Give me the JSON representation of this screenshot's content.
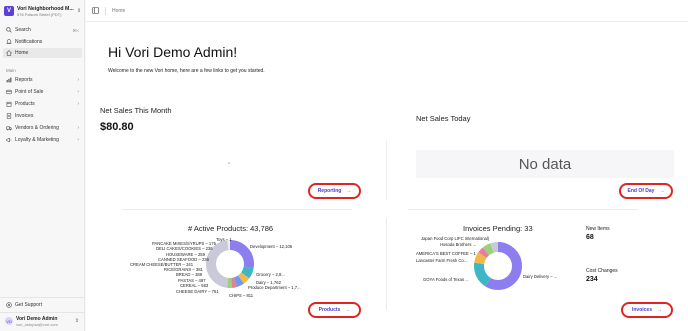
{
  "sidebar": {
    "store_name": "Vori Neighborhood M...",
    "store_address": "576 Folsom Street (PDT)",
    "logo_letter": "V",
    "search": {
      "label": "Search",
      "shortcut": "⌘K"
    },
    "notifications": {
      "label": "Notifications"
    },
    "home": {
      "label": "Home"
    },
    "section_main": "Main",
    "items": [
      {
        "label": "Reports",
        "icon": "chart-icon"
      },
      {
        "label": "Point of Sale",
        "icon": "pos-icon"
      },
      {
        "label": "Products",
        "icon": "box-icon"
      },
      {
        "label": "Invoices",
        "icon": "invoice-icon"
      },
      {
        "label": "Vendors & Ordering",
        "icon": "truck-icon"
      },
      {
        "label": "Loyalty & Marketing",
        "icon": "megaphone-icon"
      }
    ],
    "support": {
      "label": "Get Support"
    },
    "user": {
      "name": "Vori Demo Admin",
      "email": "vori_ostopsa@vori.com",
      "initials": "VD"
    }
  },
  "topbar": {
    "breadcrumb": "Home"
  },
  "main": {
    "greeting": "Hi Vori Demo Admin!",
    "welcome": "Welcome to the new Vori home, here are a few links to get you started.",
    "net_sales_month": {
      "title": "Net Sales This Month",
      "value": "$80.80",
      "button": "Reporting"
    },
    "net_sales_today": {
      "title": "Net Sales Today",
      "empty": "No data",
      "button": "End Of Day"
    },
    "active_products": {
      "title": "# Active Products: 43,786",
      "button": "Products",
      "labels_left": [
        "Toys – 1",
        "PANCAKE MIXES/SYRUPS – 175",
        "DELI CAKES/COOKIES – 236",
        "HOUSEWARE – 259",
        "CANNED SEAFOOD – 236",
        "CREAM CHEESE/BUTTER – 341",
        "RICE/GRAINS – 381",
        "BREAD – 389",
        "PASTAS – 497",
        "CEREAL – 563",
        "CHEESE DAIRY – 751"
      ],
      "labels_right": [
        "Development – 12,106",
        "Grocery – 2,9...",
        "Dairy – 1,762",
        "Produce Department – 1,7...",
        "CHIPS – 811"
      ]
    },
    "invoices": {
      "title": "Invoices Pending: 33",
      "button": "Invoices",
      "labels_left": [
        "Japan Food Corp LIFC International)",
        "Hosoda Brothers ...",
        "AMERICA'S BEST COFFEE – 1",
        "Lancaster Farm Fresh Co...",
        "GOYA Foods of Texas ..."
      ],
      "labels_right": [
        "Dairy Delivery – ..."
      ],
      "new_items_label": "New Items",
      "new_items_value": "68",
      "cost_changes_label": "Cost Changes",
      "cost_changes_value": "234"
    }
  },
  "colors": {
    "accent": "#5b3fd6",
    "highlight": "#e02424"
  }
}
